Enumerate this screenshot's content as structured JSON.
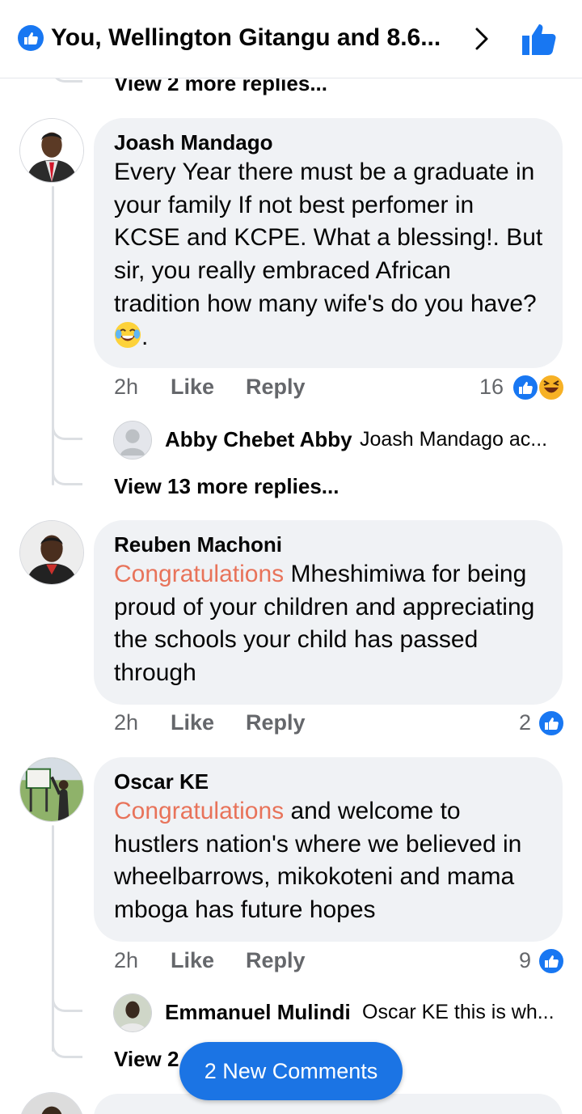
{
  "header": {
    "title": "You, Wellington Gitangu and 8.6...",
    "colors": {
      "brand_blue": "#1877f2"
    },
    "icons": [
      "like-reaction-icon",
      "chevron-right-icon",
      "thumbs-up-icon"
    ]
  },
  "top": {
    "view_more": "View 2 more replies..."
  },
  "comments": [
    {
      "author": "Joash Mandago",
      "text": "Every Year there must be a graduate in your family If not best perfomer in KCSE and KCPE. What a blessing!. But sir, you really embraced African tradition how many wife's do you have? ",
      "text_after_emoji": ".",
      "emoji": "laughing-tears-emoji",
      "time": "2h",
      "like": "Like",
      "reply": "Reply",
      "reaction_count": "16",
      "reactions": [
        "like",
        "haha"
      ],
      "reply_preview": {
        "name": "Abby Chebet Abby",
        "text": "Joash Mandago ac..."
      },
      "view_more": "View 13 more replies..."
    },
    {
      "author": "Reuben Machoni",
      "highlight": "Congratulations",
      "text": " Mheshimiwa for being proud of your children and appreciating the schools your child has passed through",
      "time": "2h",
      "like": "Like",
      "reply": "Reply",
      "reaction_count": "2",
      "reactions": [
        "like"
      ]
    },
    {
      "author": "Oscar KE",
      "highlight": "Congratulations",
      "text": " and welcome to hustlers nation's where we believed in wheelbarrows, mikokoteni and mama mboga has future hopes",
      "time": "2h",
      "like": "Like",
      "reply": "Reply",
      "reaction_count": "9",
      "reactions": [
        "like"
      ],
      "reply_preview": {
        "name": "Emmanuel Mulindi",
        "text": "Oscar KE this is wh..."
      },
      "view_more": "View 2"
    }
  ],
  "new_comments_button": "2 New Comments"
}
